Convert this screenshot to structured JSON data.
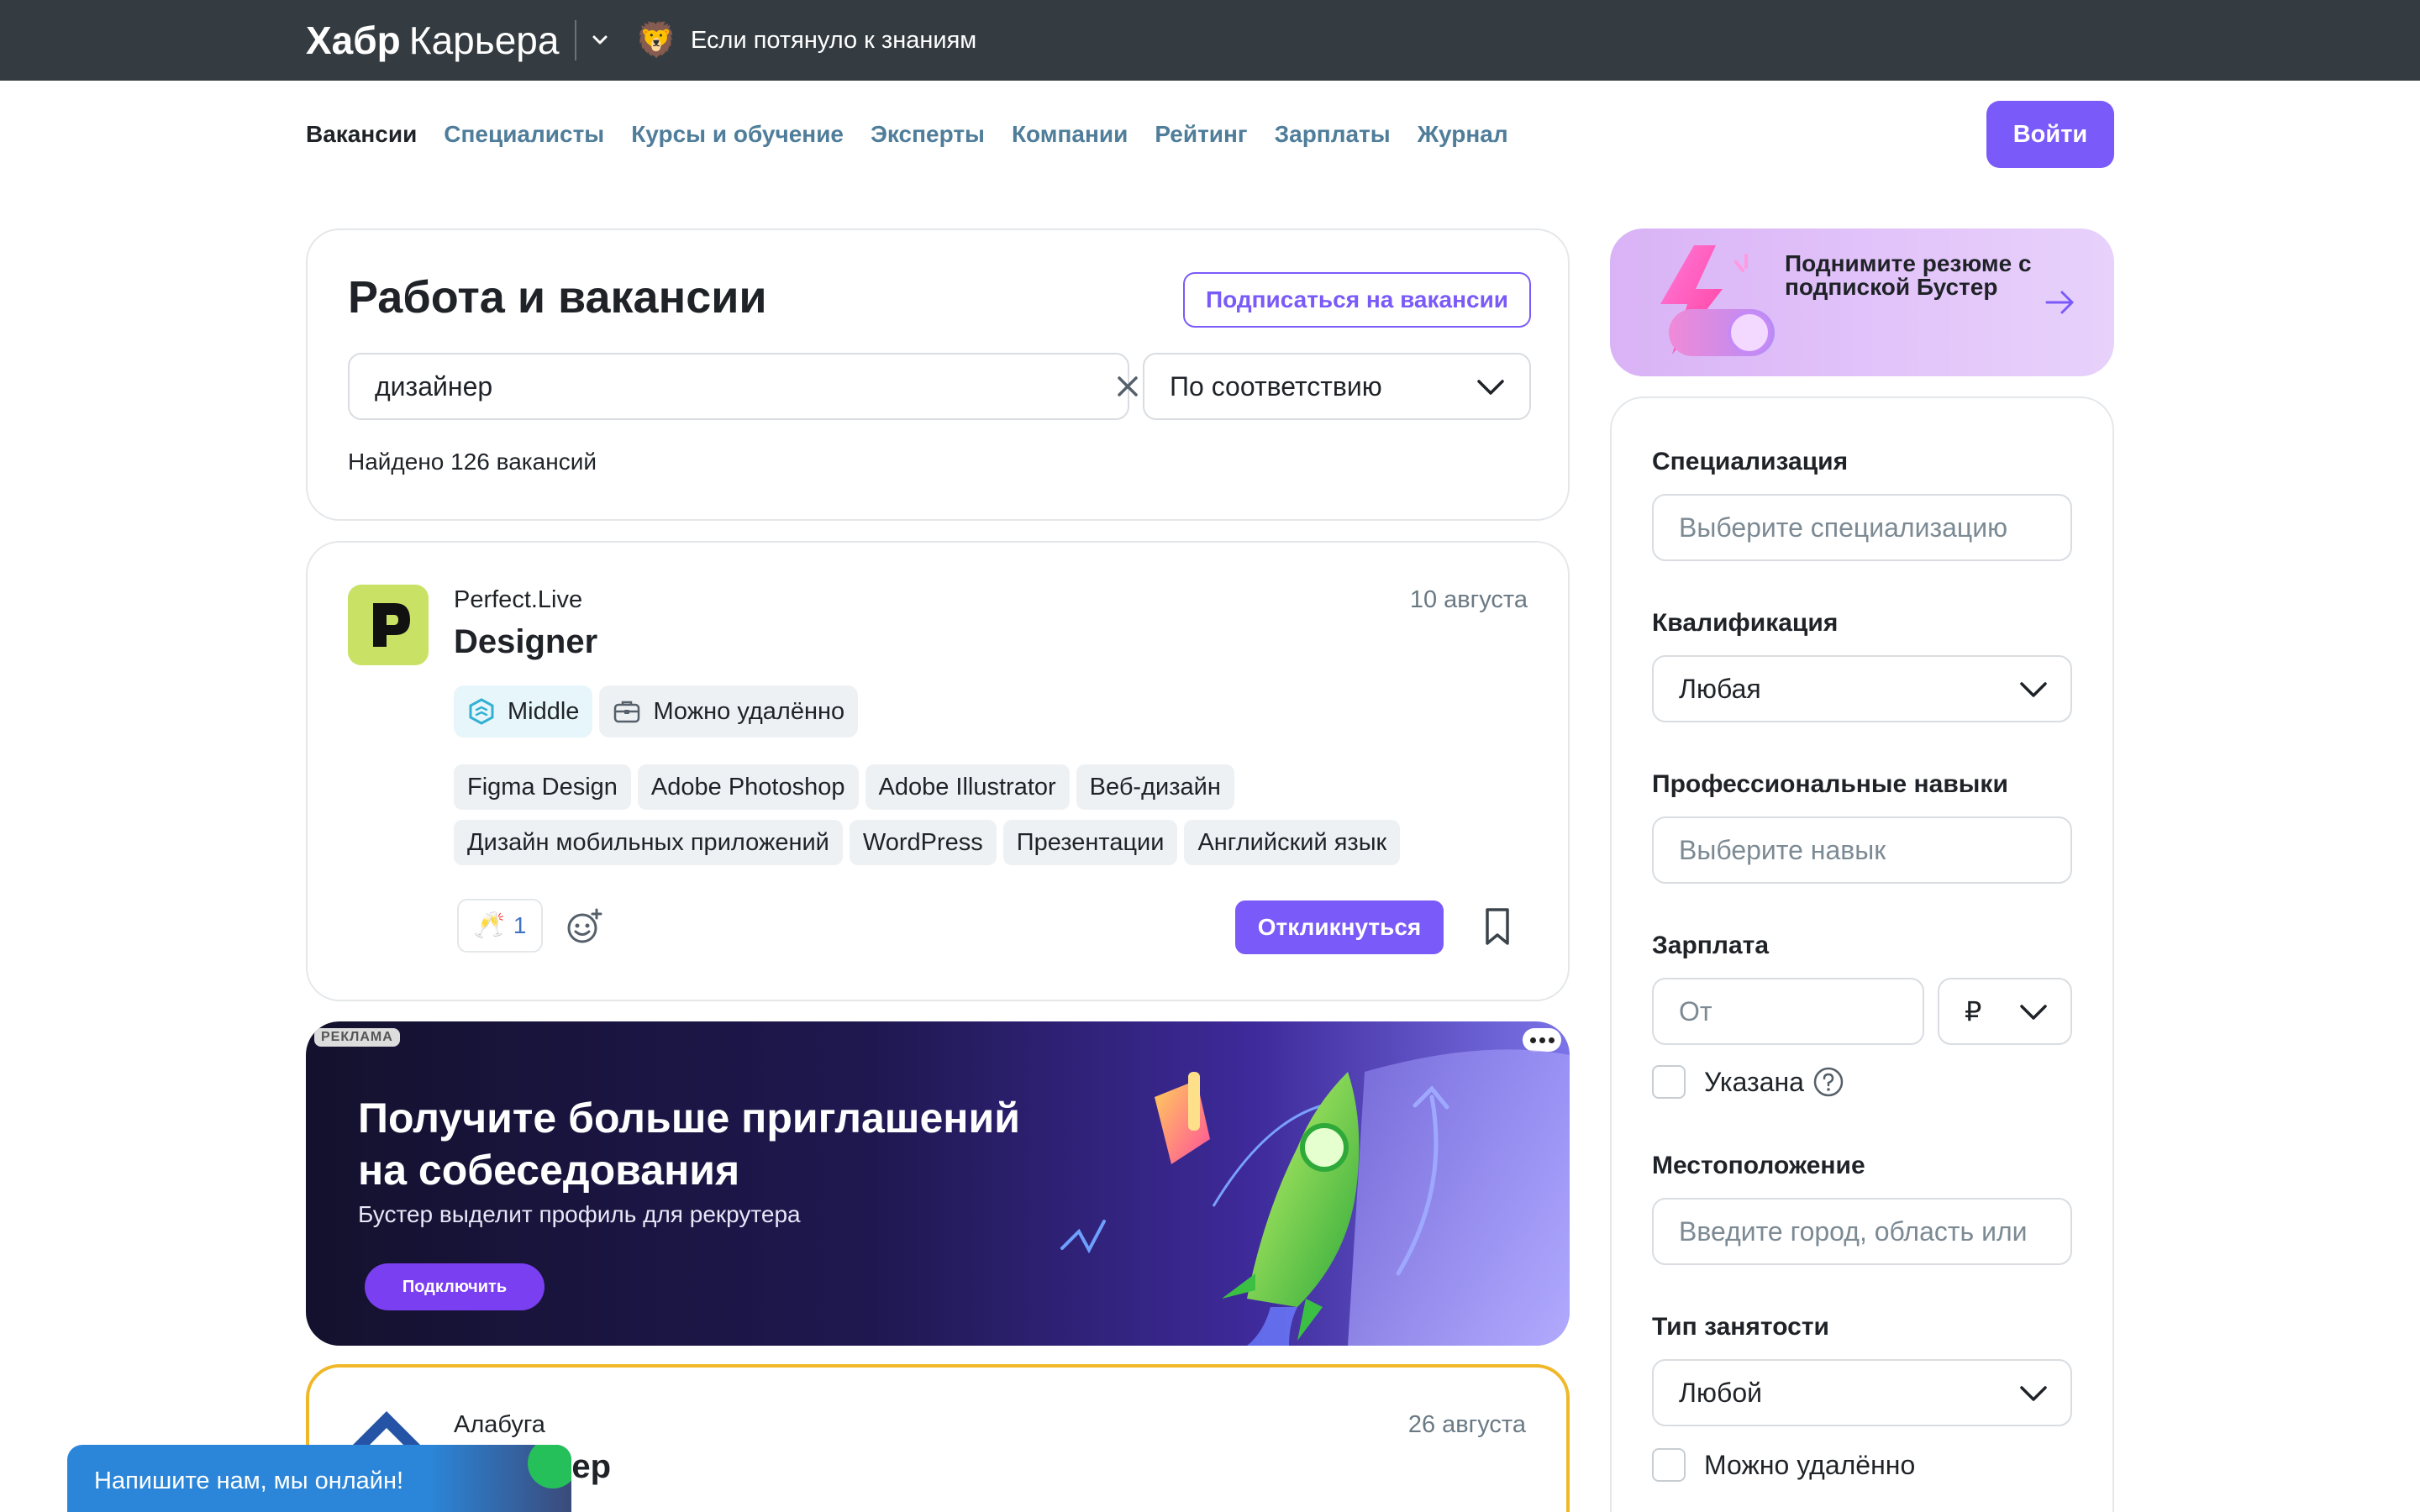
{
  "topbar": {
    "logo_bold": "Хабр",
    "logo_light": "Карьера",
    "link_text": "Если потянуло к знаниям"
  },
  "nav": {
    "items": [
      {
        "label": "Вакансии",
        "active": true
      },
      {
        "label": "Специалисты"
      },
      {
        "label": "Курсы и обучение"
      },
      {
        "label": "Эксперты"
      },
      {
        "label": "Компании"
      },
      {
        "label": "Рейтинг"
      },
      {
        "label": "Зарплаты"
      },
      {
        "label": "Журнал"
      }
    ],
    "login_label": "Войти"
  },
  "search": {
    "title": "Работа и вакансии",
    "subscribe_label": "Подписаться на вакансии",
    "query": "дизайнер",
    "sort_value": "По соответствию",
    "found_text": "Найдено 126 вакансий"
  },
  "vacancy1": {
    "company": "Perfect.Live",
    "date": "10 августа",
    "title": "Designer",
    "level": "Middle",
    "remote": "Можно удалённо",
    "skills": [
      "Figma Design",
      "Adobe Photoshop",
      "Adobe Illustrator",
      "Веб-дизайн",
      "Дизайн мобильных приложений",
      "WordPress",
      "Презентации",
      "Английский язык"
    ],
    "reaction_count": "1",
    "apply_label": "Откликнуться"
  },
  "ad": {
    "label": "РЕКЛАМА",
    "headline": "Получите больше приглашений на собеседования",
    "subtext": "Бустер выделит профиль для рекрутера",
    "button_label": "Подключить"
  },
  "vacancy2": {
    "company": "Алабуга",
    "date": "26 августа",
    "title": "дизайнер"
  },
  "chat": {
    "text": "Напишите нам, мы онлайн!"
  },
  "promo": {
    "text": "Поднимите резюме с подпиской Бустер"
  },
  "filters": {
    "specialization_label": "Специализация",
    "specialization_placeholder": "Выберите специализацию",
    "qualification_label": "Квалификация",
    "qualification_value": "Любая",
    "skills_label": "Профессиональные навыки",
    "skills_placeholder": "Выберите навык",
    "salary_label": "Зарплата",
    "salary_placeholder": "От",
    "currency": "₽",
    "salary_specified_label": "Указана",
    "location_label": "Местоположение",
    "location_placeholder": "Введите город, область или",
    "employment_label": "Тип занятости",
    "employment_value": "Любой",
    "remote_label": "Можно удалённо"
  },
  "colors": {
    "topbar": "#343c41",
    "accent": "#7a5af8",
    "nav_link": "#4f7d9a"
  }
}
